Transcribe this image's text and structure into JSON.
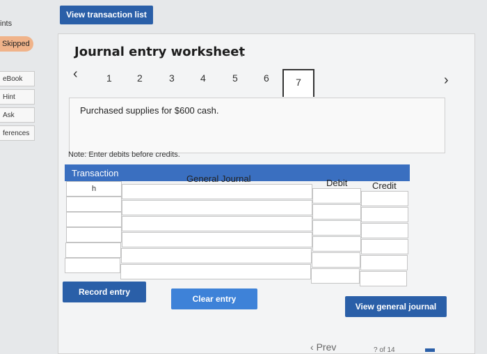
{
  "sidebar": {
    "points_label": "ints",
    "skipped_label": "Skipped",
    "tabs": [
      "eBook",
      "Hint",
      "Ask",
      "ferences"
    ]
  },
  "header": {
    "view_transactions_label": "View transaction list",
    "title": "Journal entry worksheet"
  },
  "steps": {
    "items": [
      "1",
      "2",
      "3",
      "4",
      "5",
      "6",
      "7"
    ],
    "active": "7",
    "prev_icon": "chevron-left-icon",
    "next_icon": "chevron-right-icon"
  },
  "description": "Purchased supplies for $600 cash.",
  "note": "Note: Enter debits before credits.",
  "table": {
    "headers": {
      "transaction": "Transaction",
      "general_journal": "General Journal",
      "debit": "Debit",
      "credit": "Credit"
    },
    "rows": [
      {
        "transaction": "h",
        "account": "",
        "debit": "",
        "credit": ""
      },
      {
        "transaction": "",
        "account": "",
        "debit": "",
        "credit": ""
      },
      {
        "transaction": "",
        "account": "",
        "debit": "",
        "credit": ""
      },
      {
        "transaction": "",
        "account": "",
        "debit": "",
        "credit": ""
      },
      {
        "transaction": "",
        "account": "",
        "debit": "",
        "credit": ""
      },
      {
        "transaction": "",
        "account": "",
        "debit": "",
        "credit": ""
      }
    ]
  },
  "buttons": {
    "record_entry": "Record entry",
    "clear_entry": "Clear entry",
    "view_general_journal": "View general journal"
  },
  "pager": {
    "prev_label": "Prev",
    "count": "? of 14"
  },
  "colors": {
    "primary": "#2a5fa8",
    "header_blue": "#3a6fc0",
    "skipped": "#f0b38a"
  }
}
